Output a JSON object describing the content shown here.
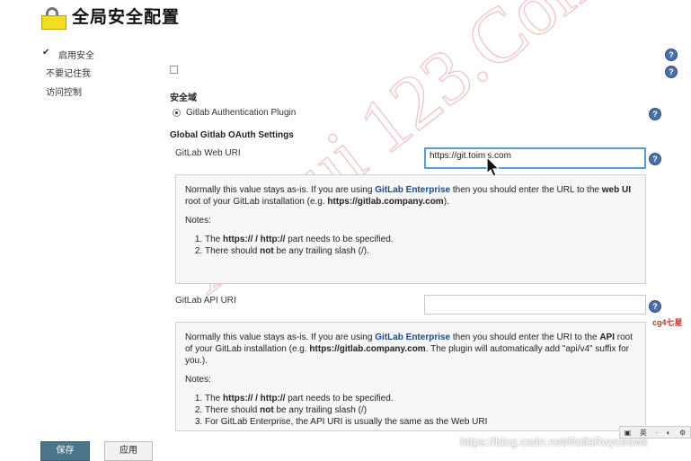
{
  "header": {
    "title": "全局安全配置",
    "icon": "lock-icon"
  },
  "sidebar_options": {
    "enable_security": {
      "label": "启用安全",
      "checked": true
    },
    "dont_remember_me": {
      "label": "不要记住我",
      "checked": false
    },
    "access_control": {
      "label": "访问控制"
    }
  },
  "security_realm": {
    "heading": "安全域",
    "selected_option": "Gitlab Authentication Plugin"
  },
  "oauth": {
    "heading": "Global Gitlab OAuth Settings",
    "web_uri": {
      "label": "GitLab Web URI",
      "value": "https://git.toim s.com",
      "help": {
        "p1_pre": "Normally this value stays as-is. If you are using ",
        "p1_link": "GitLab Enterprise",
        "p1_mid": " then you should enter the URL to the ",
        "p1_b1": "web UI",
        "p1_mid2": " root of your GitLab installation (e.g. ",
        "p1_b2": "https://gitlab.company.com",
        "p1_end": ").",
        "notes_label": "Notes:",
        "n1_pre": "The ",
        "n1_b": "https:// / http://",
        "n1_end": " part needs to be specified.",
        "n2_pre": "There should ",
        "n2_b": "not",
        "n2_end": " be any trailing slash (/)."
      }
    },
    "api_uri": {
      "label": "GitLab API URI",
      "value": "",
      "help": {
        "p1_pre": "Normally this value stays as-is. If you are using ",
        "p1_link": "GitLab Enterprise",
        "p1_mid": " then you should enter the URI to the ",
        "p1_b1": "API",
        "p1_mid2": " root of your GitLab installation (e.g. ",
        "p1_b2": "https://gitlab.company.com",
        "p1_end": ". The plugin will automatically add \"api/v4\" suffix for you.).",
        "notes_label": "Notes:",
        "n1_pre": "The ",
        "n1_b": "https:// / http://",
        "n1_end": " part needs to be specified.",
        "n2_pre": "There should ",
        "n2_b": "not",
        "n2_end": " be any trailing slash (/)",
        "n3": "For GitLab Enterprise, the API URI is usually the same as the Web URI"
      }
    }
  },
  "help_icon_glyph": "?",
  "side_note": "cg4七星",
  "watermarks": {
    "diagonal": "Xue ui 123.Com",
    "csdn": "https://blog.csdn.net/RollsRoyceewk"
  },
  "buttons": {
    "save": "保存",
    "apply": "应用"
  },
  "toolbar_glyphs": [
    "▣",
    "英",
    "·",
    "◐",
    "⚙"
  ]
}
